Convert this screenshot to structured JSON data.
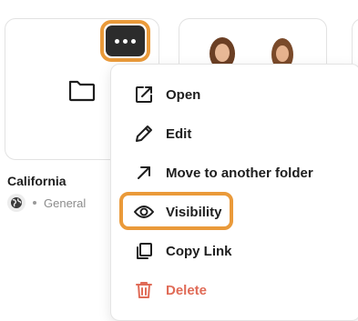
{
  "folder_card": {
    "title": "California",
    "visibility_label": "General",
    "more_button_icon": "ellipsis-icon",
    "folder_icon": "folder-icon",
    "visibility_icon": "globe-icon"
  },
  "context_menu": {
    "items": [
      {
        "label": "Open",
        "icon": "external-link-icon"
      },
      {
        "label": "Edit",
        "icon": "pencil-icon"
      },
      {
        "label": "Move to another folder",
        "icon": "arrow-up-right-icon"
      },
      {
        "label": "Visibility",
        "icon": "eye-icon"
      },
      {
        "label": "Copy Link",
        "icon": "copy-icon"
      },
      {
        "label": "Delete",
        "icon": "trash-icon"
      }
    ]
  },
  "colors": {
    "highlight": "#ea9a3a",
    "danger": "#e06b57",
    "button_dark": "#2c2c2c"
  }
}
